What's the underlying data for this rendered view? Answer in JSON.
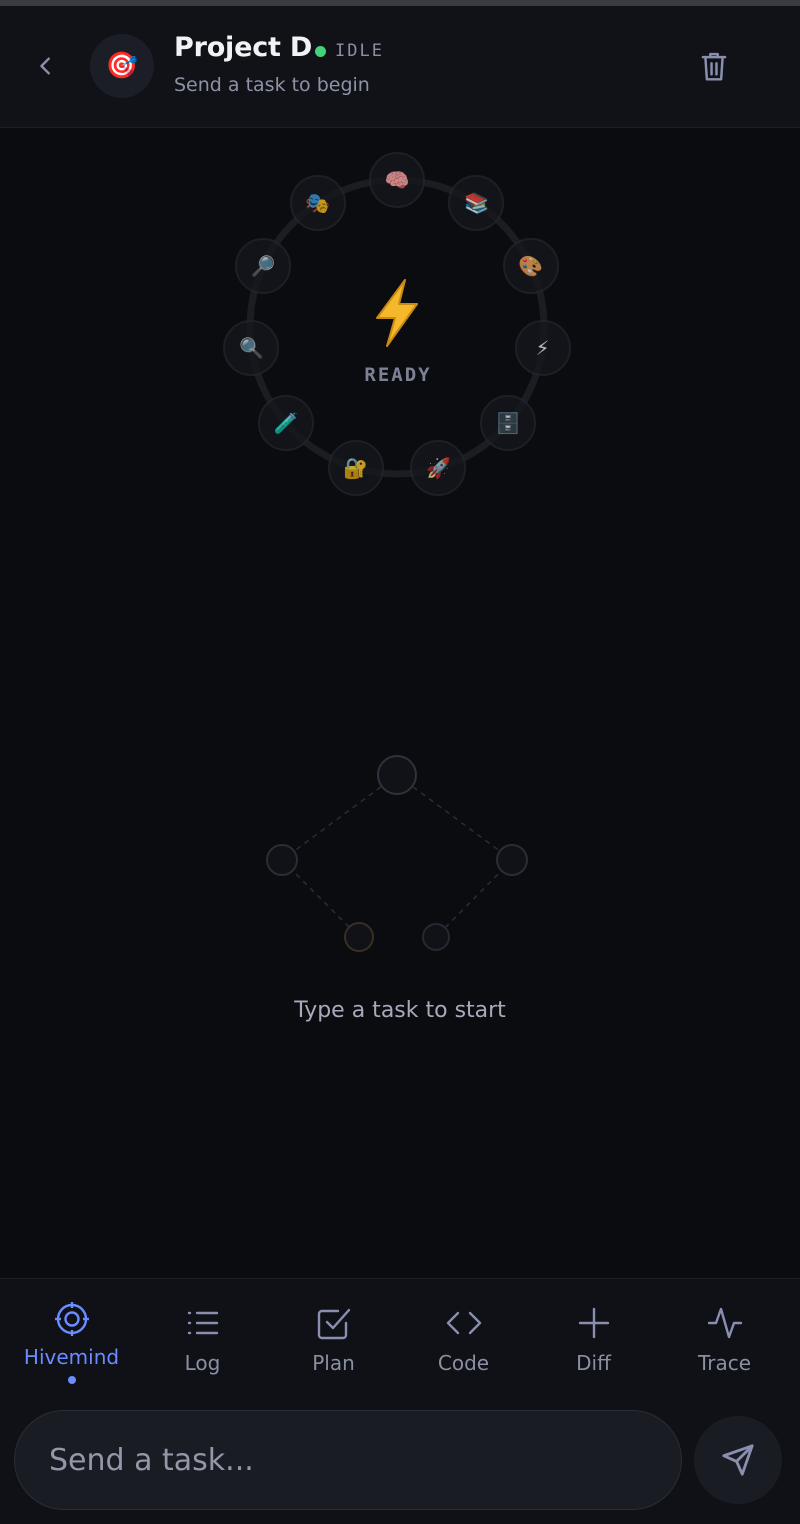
{
  "header": {
    "title": "Project D",
    "status": "IDLE",
    "status_color": "#46d07a",
    "subtitle": "Send a task to begin",
    "avatar_emoji": "🎯"
  },
  "hivemind": {
    "center_icon": "⚡",
    "center_label": "READY",
    "agents": [
      {
        "emoji": "🧠",
        "name": "brain-agent"
      },
      {
        "emoji": "📚",
        "name": "books-agent"
      },
      {
        "emoji": "🎨",
        "name": "palette-agent"
      },
      {
        "emoji": "⚡",
        "name": "bolt-agent"
      },
      {
        "emoji": "🗄️",
        "name": "cabinet-agent"
      },
      {
        "emoji": "🚀",
        "name": "rocket-agent"
      },
      {
        "emoji": "🔐",
        "name": "lock-agent"
      },
      {
        "emoji": "🧪",
        "name": "testtube-agent"
      },
      {
        "emoji": "🔍",
        "name": "search-agent"
      },
      {
        "emoji": "🔎",
        "name": "inspect-agent"
      },
      {
        "emoji": "🎭",
        "name": "masks-agent"
      }
    ]
  },
  "empty_state": {
    "message": "Type a task to start"
  },
  "nav": {
    "items": [
      {
        "label": "Hivemind",
        "icon": "target-icon",
        "active": true
      },
      {
        "label": "Log",
        "icon": "list-icon",
        "active": false
      },
      {
        "label": "Plan",
        "icon": "checkbox-icon",
        "active": false
      },
      {
        "label": "Code",
        "icon": "code-icon",
        "active": false
      },
      {
        "label": "Diff",
        "icon": "plus-icon",
        "active": false
      },
      {
        "label": "Trace",
        "icon": "pulse-icon",
        "active": false
      }
    ]
  },
  "composer": {
    "placeholder": "Send a task...",
    "value": ""
  },
  "colors": {
    "accent": "#6b8cff",
    "background": "#0b0c10",
    "surface": "#101217"
  }
}
